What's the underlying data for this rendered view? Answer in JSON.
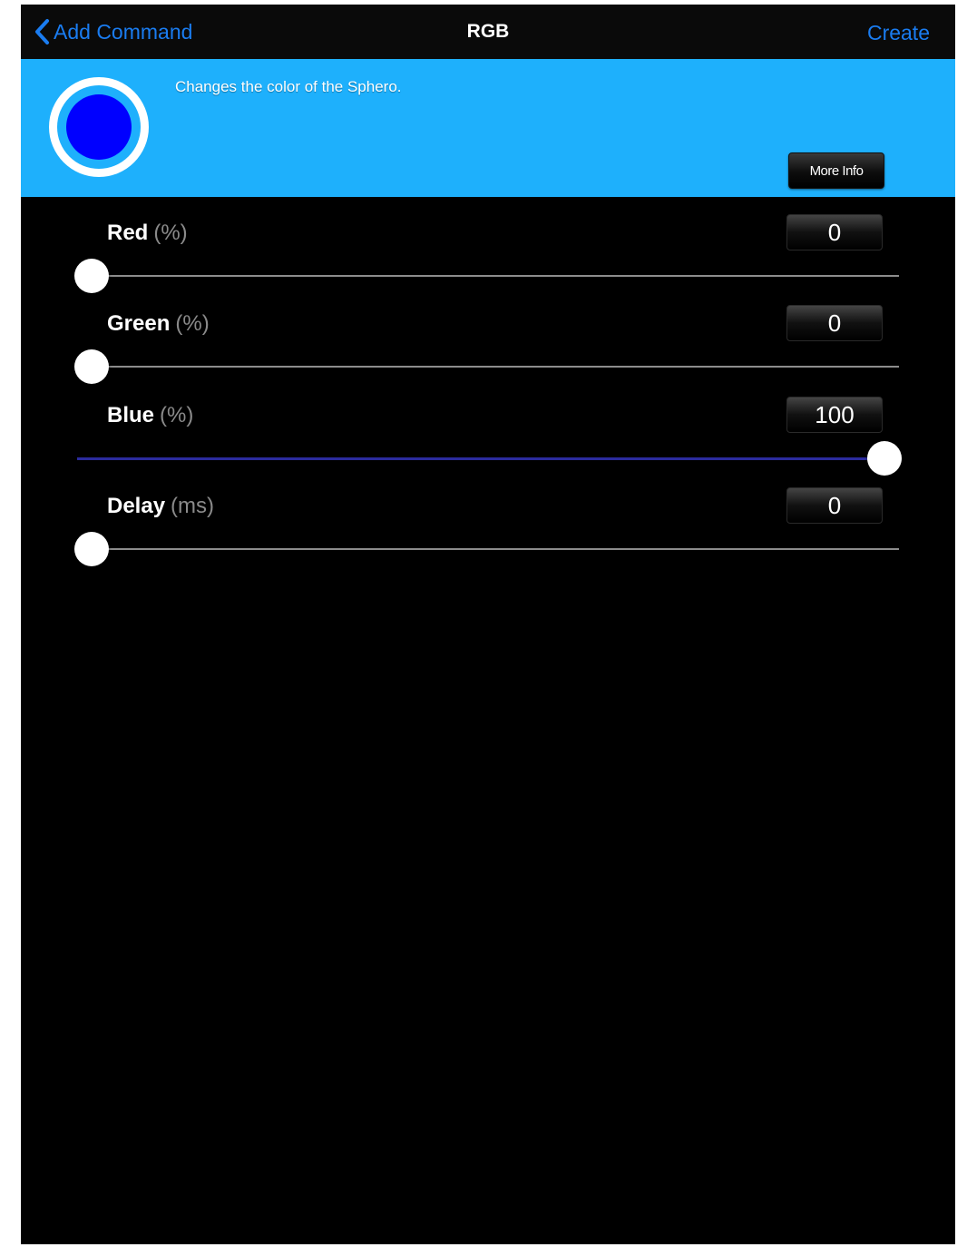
{
  "nav": {
    "back_label": "Add Command",
    "title": "RGB",
    "create_label": "Create"
  },
  "banner": {
    "description": "Changes the color of the Sphero.",
    "more_info_label": "More Info",
    "icon": "sphere-color-icon",
    "background_color": "#1eb0fc",
    "sphere_color": "#0000ff"
  },
  "controls": [
    {
      "label": "Red",
      "unit": "(%)",
      "value": "0",
      "fraction": 0.0
    },
    {
      "label": "Green",
      "unit": "(%)",
      "value": "0",
      "fraction": 0.0
    },
    {
      "label": "Blue",
      "unit": "(%)",
      "value": "100",
      "fraction": 1.0
    },
    {
      "label": "Delay",
      "unit": "(ms)",
      "value": "0",
      "fraction": 0.0
    }
  ],
  "colors": {
    "accent": "#1a7cf0",
    "slider_fill": "#2b2b9e",
    "track": "#8c8c8c"
  }
}
